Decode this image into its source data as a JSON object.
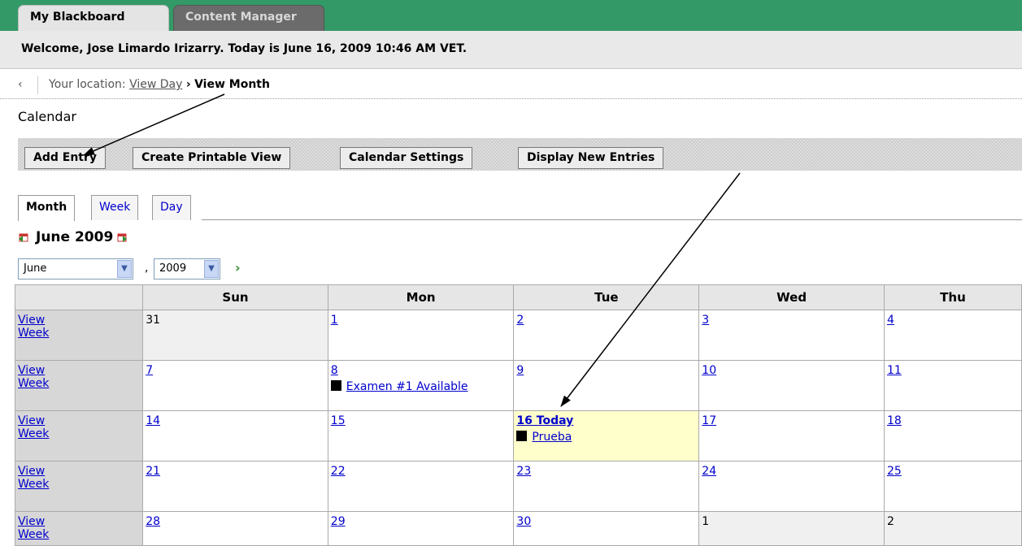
{
  "tabs": [
    {
      "label": "My Blackboard",
      "active": true
    },
    {
      "label": "Content Manager",
      "active": false
    }
  ],
  "welcome": "Welcome, Jose Limardo Irizarry. Today is June 16, 2009 10:46 AM VET.",
  "breadcrumb": {
    "prefix": "Your location:",
    "link": "View Day",
    "separator": "›",
    "current": "View Month"
  },
  "page_title": "Calendar",
  "actions": {
    "add_entry": "Add Entry",
    "printable": "Create Printable View",
    "settings": "Calendar Settings",
    "new_entries": "Display New Entries"
  },
  "view_tabs": {
    "month": "Month",
    "week": "Week",
    "day": "Day"
  },
  "month_heading": "June 2009",
  "selectors": {
    "month": "June",
    "year": "2009"
  },
  "calendar": {
    "headers": [
      "",
      "Sun",
      "Mon",
      "Tue",
      "Wed",
      "Thu"
    ],
    "view_week_label": "View Week",
    "weeks": [
      {
        "days": [
          {
            "n": "31",
            "other": true
          },
          {
            "n": "1"
          },
          {
            "n": "2"
          },
          {
            "n": "3"
          },
          {
            "n": "4"
          }
        ]
      },
      {
        "days": [
          {
            "n": "7"
          },
          {
            "n": "8",
            "event": "Examen #1 Available"
          },
          {
            "n": "9"
          },
          {
            "n": "10"
          },
          {
            "n": "11"
          }
        ]
      },
      {
        "days": [
          {
            "n": "14"
          },
          {
            "n": "15"
          },
          {
            "n": "16 Today",
            "today": true,
            "event": "Prueba"
          },
          {
            "n": "17"
          },
          {
            "n": "18"
          }
        ]
      },
      {
        "days": [
          {
            "n": "21"
          },
          {
            "n": "22"
          },
          {
            "n": "23"
          },
          {
            "n": "24"
          },
          {
            "n": "25"
          }
        ]
      },
      {
        "days": [
          {
            "n": "28"
          },
          {
            "n": "29"
          },
          {
            "n": "30"
          },
          {
            "n": "1",
            "other": true
          },
          {
            "n": "2",
            "other": true
          }
        ]
      }
    ]
  },
  "colors": {
    "tab_bar": "#339966",
    "today": "#ffffcc",
    "link": "#0000cc"
  }
}
